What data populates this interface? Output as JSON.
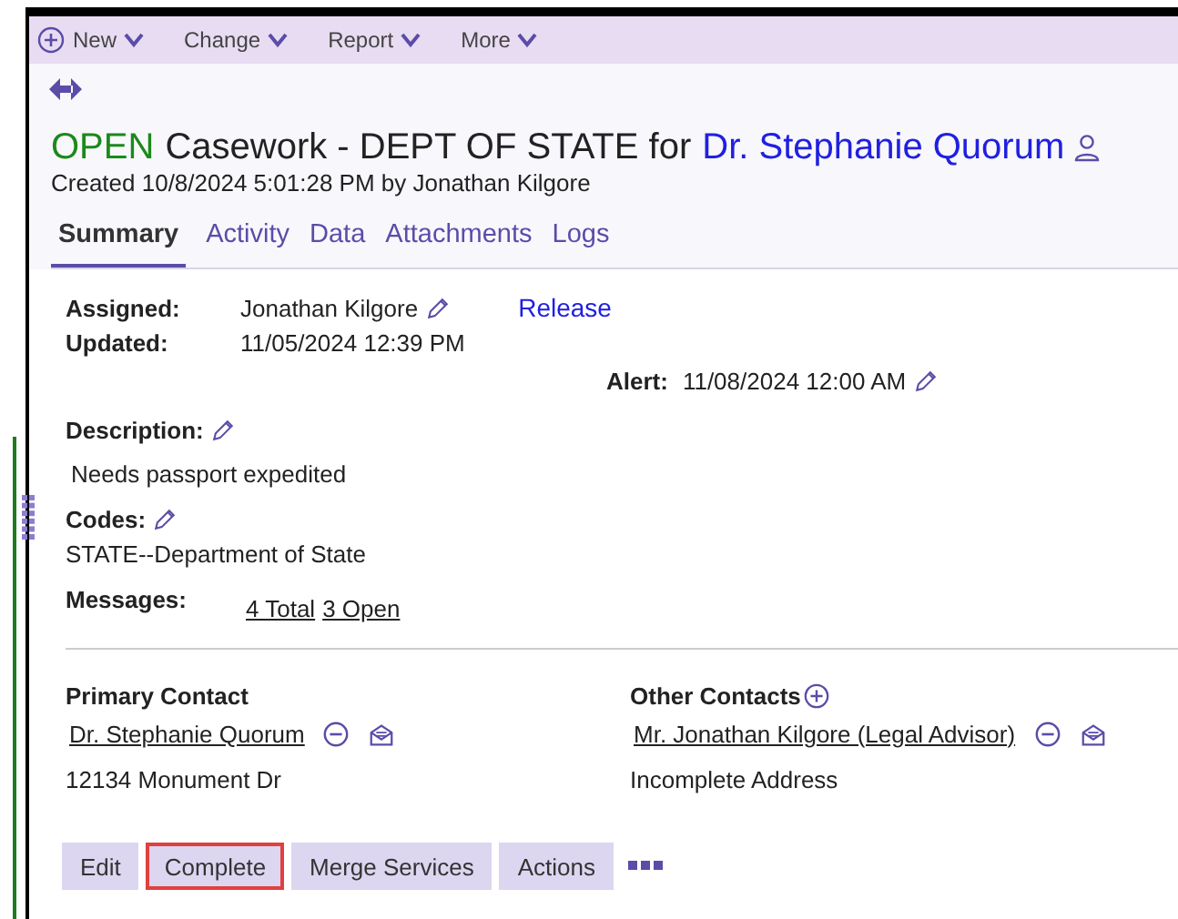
{
  "toolbar": {
    "items": [
      {
        "label": "New",
        "kind": "add"
      },
      {
        "label": "Change",
        "kind": "menu"
      },
      {
        "label": "Report",
        "kind": "menu"
      },
      {
        "label": "More",
        "kind": "menu"
      }
    ]
  },
  "header": {
    "status": "OPEN",
    "title": "Casework - DEPT OF STATE for",
    "contact": "Dr. Stephanie Quorum",
    "created": "Created 10/8/2024 5:01:28 PM by Jonathan Kilgore"
  },
  "tabs": [
    {
      "label": "Summary",
      "selected": true
    },
    {
      "label": "Activity",
      "selected": false
    },
    {
      "label": "Data",
      "selected": false
    },
    {
      "label": "Attachments",
      "selected": false
    },
    {
      "label": "Logs",
      "selected": false
    }
  ],
  "summary": {
    "assigned_label": "Assigned:",
    "assigned": "Jonathan Kilgore",
    "release": "Release",
    "updated_label": "Updated:",
    "updated": "11/05/2024 12:39 PM",
    "alert_label": "Alert:",
    "alert": "11/08/2024 12:00 AM",
    "description_label": "Description:",
    "description": "Needs passport expedited",
    "codes_label": "Codes:",
    "codes": "STATE--Department of State",
    "messages_label": "Messages:",
    "messages": [
      "4 Total",
      "3 Open"
    ]
  },
  "primary_contact": {
    "heading": "Primary Contact",
    "name": "Dr. Stephanie Quorum",
    "address": "12134 Monument Dr"
  },
  "other_contacts": {
    "heading": "Other Contacts",
    "name": "Mr. Jonathan Kilgore (Legal Advisor)",
    "address": "Incomplete Address"
  },
  "buttons": [
    {
      "label": "Edit",
      "highlighted": false
    },
    {
      "label": "Complete",
      "highlighted": true
    },
    {
      "label": "Merge Services",
      "highlighted": false
    },
    {
      "label": "Actions",
      "highlighted": false
    }
  ]
}
